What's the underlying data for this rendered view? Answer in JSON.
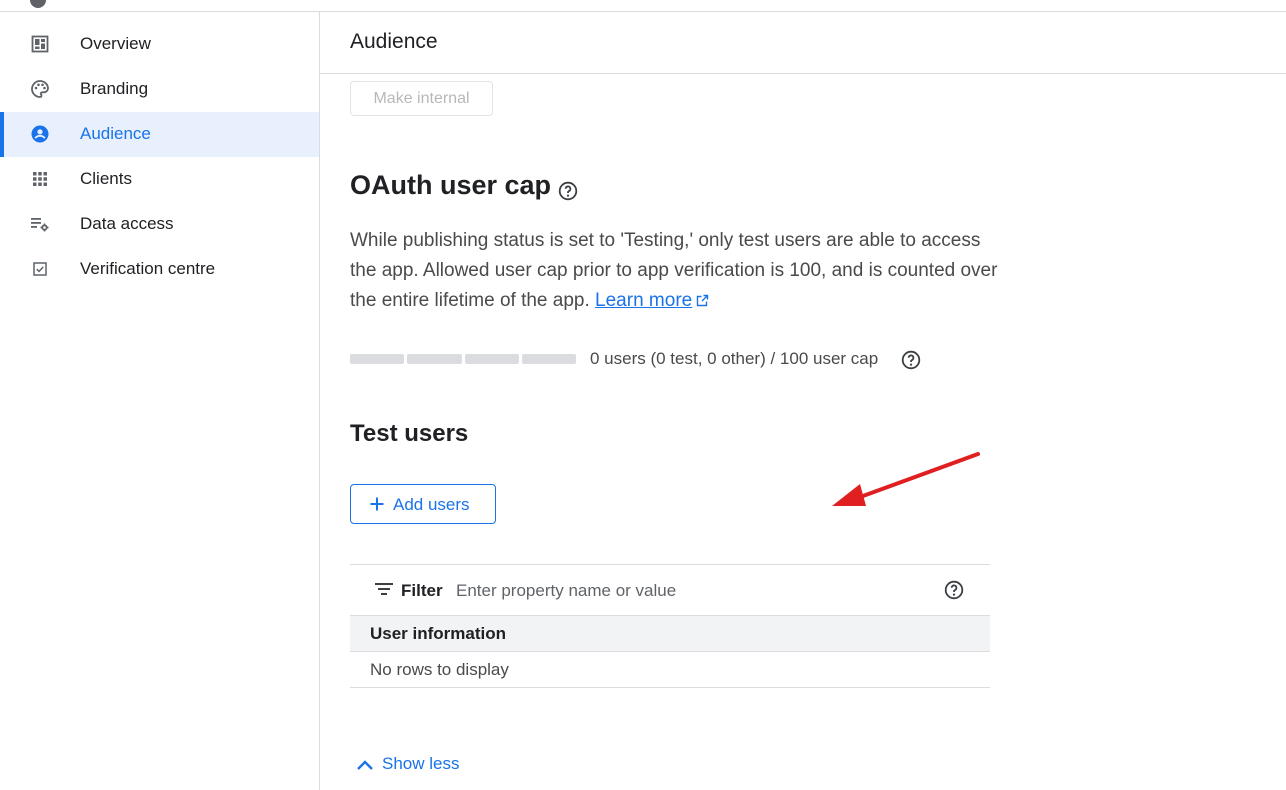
{
  "sidebar": {
    "items": [
      {
        "label": "Overview",
        "icon": "dashboard-icon"
      },
      {
        "label": "Branding",
        "icon": "palette-icon"
      },
      {
        "label": "Audience",
        "icon": "account-circle-icon",
        "active": true
      },
      {
        "label": "Clients",
        "icon": "grid-icon"
      },
      {
        "label": "Data access",
        "icon": "data-settings-icon"
      },
      {
        "label": "Verification centre",
        "icon": "checkbox-icon"
      }
    ]
  },
  "main": {
    "title": "Audience",
    "make_internal_label": "Make internal",
    "oauth": {
      "title": "OAuth user cap",
      "description": "While publishing status is set to 'Testing,' only test users are able to access the app. Allowed user cap prior to app verification is 100, and is counted over the entire lifetime of the app.",
      "learn_more": "Learn more",
      "cap_text": "0 users (0 test, 0 other) / 100 user cap",
      "cap_fraction": 0.0
    },
    "test_users": {
      "title": "Test users",
      "add_users_label": "Add users",
      "filter_label": "Filter",
      "filter_placeholder": "Enter property name or value",
      "column_header": "User information",
      "empty_text": "No rows to display"
    },
    "show_less_label": "Show less"
  },
  "colors": {
    "accent": "#1a73e8",
    "active_bg": "#e8f0fe",
    "annotation_arrow": "#e02020"
  }
}
